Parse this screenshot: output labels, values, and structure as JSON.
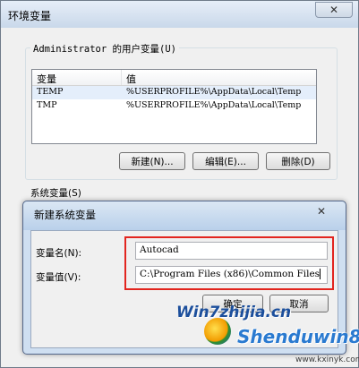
{
  "env_window": {
    "title": "环境变量",
    "close_glyph": "✕",
    "user_vars": {
      "group_label": "Administrator 的用户变量(U)",
      "headers": {
        "name": "变量",
        "value": "值"
      },
      "rows": [
        {
          "name": "TEMP",
          "value": "%USERPROFILE%\\AppData\\Local\\Temp"
        },
        {
          "name": "TMP",
          "value": "%USERPROFILE%\\AppData\\Local\\Temp"
        }
      ],
      "buttons": {
        "new": "新建(N)...",
        "edit": "编辑(E)...",
        "delete": "删除(D)"
      }
    },
    "system_vars": {
      "group_label": "系统变量(S)"
    }
  },
  "dialog": {
    "title": "新建系统变量",
    "close_glyph": "✕",
    "name_label": "变量名(N):",
    "name_value": "Autocad",
    "value_label": "变量值(V):",
    "value_value": "C:\\Program Files (x86)\\Common Files",
    "buttons": {
      "ok": "确定",
      "cancel": "取消"
    }
  },
  "watermark": {
    "main": "Win7zhijia.cn",
    "brand": "Shenduwin8",
    "site": "www.kxinyk.com"
  },
  "colors": {
    "highlight": "#e2251f",
    "titlebar": "#c9d8ea",
    "watermark": "#1c4f9c"
  }
}
